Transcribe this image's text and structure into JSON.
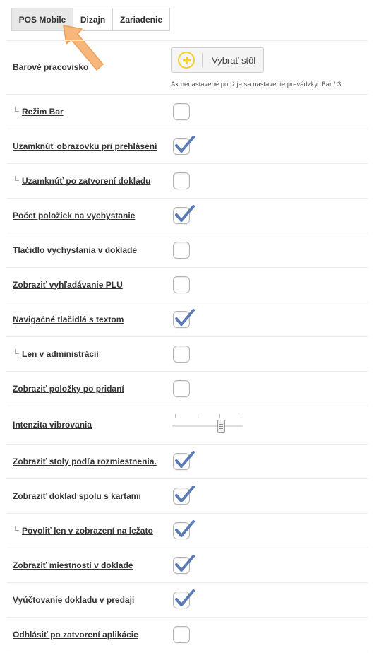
{
  "tabs": [
    {
      "label": "POS Mobile",
      "active": true
    },
    {
      "label": "Dizajn",
      "active": false
    },
    {
      "label": "Zariadenie",
      "active": false
    }
  ],
  "workplace": {
    "label": "Barové pracovisko",
    "button_label": "Vybrať stôl",
    "hint": "Ak nenastavené použije sa nastavenie prevádzky: Bar \\ 3"
  },
  "settings": [
    {
      "label": "Režim Bar",
      "sub": true,
      "checked": false
    },
    {
      "label": "Uzamknúť obrazovku pri prehlásení",
      "sub": false,
      "checked": true
    },
    {
      "label": "Uzamknúť po zatvorení dokladu",
      "sub": true,
      "checked": false
    },
    {
      "label": "Počet položiek na vychystanie",
      "sub": false,
      "checked": true
    },
    {
      "label": "Tlačidlo vychystania v doklade",
      "sub": false,
      "checked": false
    },
    {
      "label": "Zobraziť vyhľadávanie PLU",
      "sub": false,
      "checked": false
    },
    {
      "label": "Navigačné tlačidlá s textom",
      "sub": false,
      "checked": true
    },
    {
      "label": "Len v administrácií",
      "sub": true,
      "checked": false
    },
    {
      "label": "Zobraziť položky po pridaní",
      "sub": false,
      "checked": false
    }
  ],
  "vibration": {
    "label": "Intenzita vibrovania",
    "value": 0.65
  },
  "settings2": [
    {
      "label": "Zobraziť stoly podľa rozmiestnenia.",
      "sub": false,
      "checked": true
    },
    {
      "label": "Zobraziť doklad spolu s kartami",
      "sub": false,
      "checked": true
    },
    {
      "label": "Povoliť len v zobrazení na ležato",
      "sub": true,
      "checked": true
    },
    {
      "label": "Zobraziť miestnosti v doklade",
      "sub": false,
      "checked": true
    },
    {
      "label": "Vyúčtovanie dokladu v predaji",
      "sub": false,
      "checked": true
    },
    {
      "label": "Odhlásiť po zatvorení aplikácie",
      "sub": false,
      "checked": false
    }
  ],
  "colors": {
    "accent": "#5a7bb5",
    "arrow": "#f7b77a"
  }
}
